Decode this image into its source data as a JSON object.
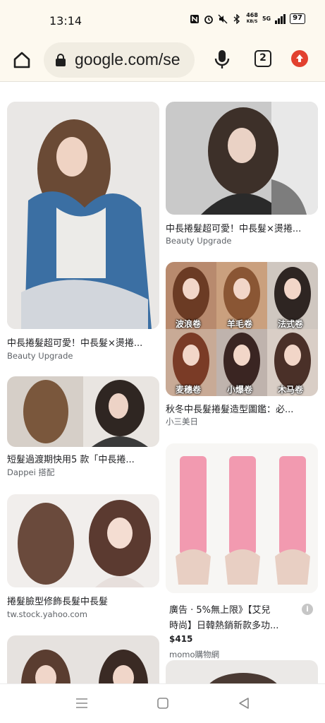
{
  "status_bar": {
    "time": "13:14",
    "net_speed_value": "468",
    "net_speed_unit": "KB/S",
    "network": "5G",
    "battery": "97",
    "icons": [
      "nfc-icon",
      "alarm-icon",
      "mute-icon",
      "bluetooth-icon",
      "signal-icon",
      "battery-icon"
    ]
  },
  "toolbar": {
    "url": "google.com/se",
    "tab_count": "2",
    "icons": [
      "home-icon",
      "lock-icon",
      "mic-icon",
      "tab-switcher-icon",
      "update-icon"
    ]
  },
  "results": [
    {
      "title": "中長捲髮超可愛！中長髮×燙捲...",
      "source": "Beauty Upgrade"
    },
    {
      "title": "中長捲髮超可愛！中長髮×燙捲...",
      "source": "Beauty Upgrade"
    },
    {
      "title": "秋冬中長髮捲髮造型圖鑑：必...",
      "source": "小三美日",
      "tags": [
        "波浪卷",
        "羊毛卷",
        "法式卷",
        "麦穗卷",
        "小爆卷",
        "木马卷"
      ]
    },
    {
      "title": "短髮過渡期快用5 款「中長捲...",
      "source": "Dappei 搭配"
    },
    {
      "title": "捲髮臉型修飾長髮中長髮",
      "source": "tw.stock.yahoo.com"
    }
  ],
  "ad": {
    "line1": "廣告 · 5%無上限》【艾兒",
    "line2": "時尚】日韓熱銷新款多功...",
    "price": "$415",
    "seller": "momo購物網",
    "info_glyph": "i"
  },
  "colors": {
    "chrome_bg": "#fdf9ef",
    "url_pill": "#f1ede2",
    "update_red": "#e2412f",
    "source_gray": "#5f6368"
  }
}
